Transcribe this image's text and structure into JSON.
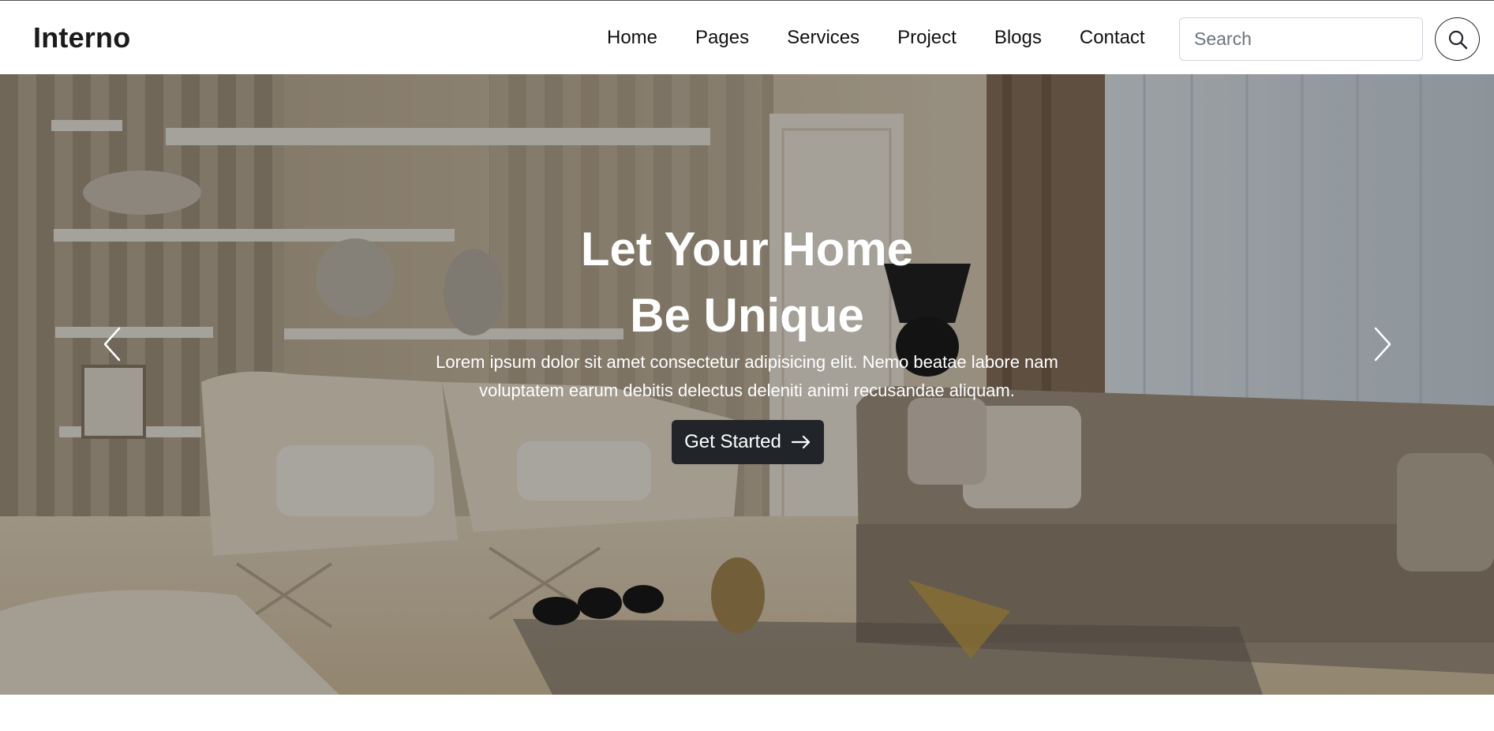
{
  "brand": {
    "name": "Interno"
  },
  "nav": {
    "items": [
      {
        "label": "Home"
      },
      {
        "label": "Pages"
      },
      {
        "label": "Services"
      },
      {
        "label": "Project"
      },
      {
        "label": "Blogs"
      },
      {
        "label": "Contact"
      }
    ]
  },
  "search": {
    "placeholder": "Search",
    "value": "",
    "button_icon": "search-icon"
  },
  "hero": {
    "title_line_1": "Let Your Home",
    "title_line_2": "Be Unique",
    "text_line_1": "Lorem ipsum dolor sit amet consectetur adipisicing elit. Nemo beatae labore nam",
    "text_line_2": "voluptatem earum debitis delectus deleniti animi recusandae aliquam.",
    "cta_label": "Get Started",
    "cta_icon": "arrow-right-icon",
    "prev_icon": "chevron-left-icon",
    "next_icon": "chevron-right-icon"
  },
  "colors": {
    "navbar_bg": "#ffffff",
    "button_dark": "#212529",
    "hero_text": "#ffffff"
  }
}
